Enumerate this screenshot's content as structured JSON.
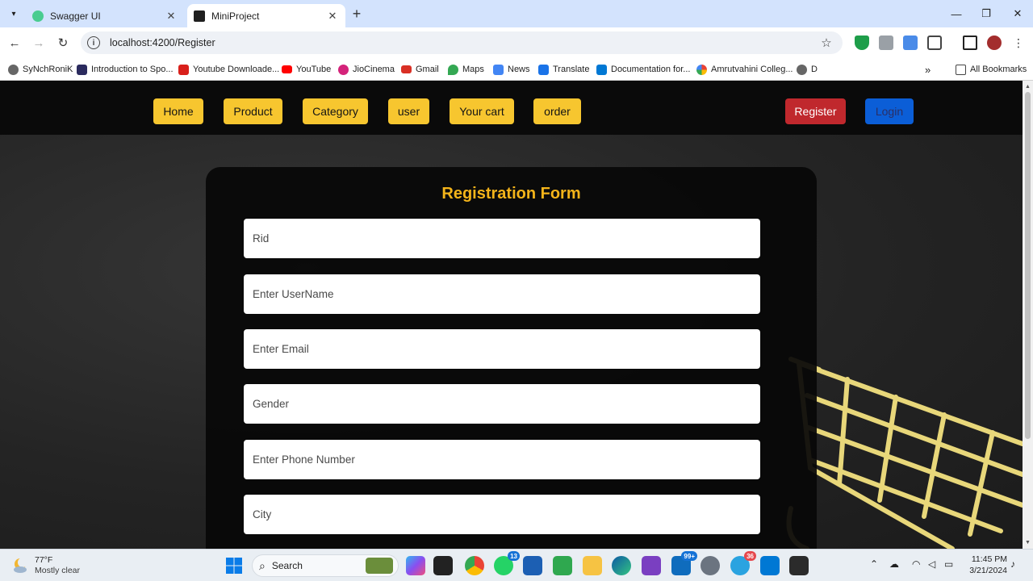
{
  "browser": {
    "tabs": [
      {
        "title": "Swagger UI",
        "active": false,
        "favicon_color": "#49cc90"
      },
      {
        "title": "MiniProject",
        "active": true,
        "favicon_color": "#1f1f1f"
      }
    ],
    "url": "localhost:4200/Register",
    "bookmarks": [
      {
        "label": "SyNchRoniK",
        "icon": "globe-icon",
        "color": "#555555"
      },
      {
        "label": "Introduction to Spo...",
        "icon": "page-icon",
        "color": "#2b2b5e"
      },
      {
        "label": "Youtube Downloade...",
        "icon": "red-download-icon",
        "color": "#d9201b"
      },
      {
        "label": "YouTube",
        "icon": "youtube-icon",
        "color": "#ff0000"
      },
      {
        "label": "JioCinema",
        "icon": "jiocinema-icon",
        "color": "#d4237a"
      },
      {
        "label": "Gmail",
        "icon": "gmail-icon",
        "color": "#d93025"
      },
      {
        "label": "Maps",
        "icon": "maps-icon",
        "color": "#34a853"
      },
      {
        "label": "News",
        "icon": "news-icon",
        "color": "#4285f4"
      },
      {
        "label": "Translate",
        "icon": "translate-icon",
        "color": "#1a73e8"
      },
      {
        "label": "Documentation for...",
        "icon": "vscode-icon",
        "color": "#0078d4"
      },
      {
        "label": "Amrutvahini Colleg...",
        "icon": "google-icon",
        "color": "#4285f4"
      },
      {
        "label": "D",
        "icon": "globe-icon",
        "color": "#555555"
      }
    ],
    "all_bookmarks": "All Bookmarks"
  },
  "navbar": {
    "items": [
      "Home",
      "Product",
      "Category",
      "user",
      "Your cart",
      "order"
    ],
    "register": "Register",
    "login": "Login",
    "accent": "#f7c62f",
    "register_color": "#c0282d",
    "login_color": "#0b5ed7"
  },
  "form": {
    "title": "Registration Form",
    "title_color": "#f4b41a",
    "fields": [
      {
        "placeholder": "Rid"
      },
      {
        "placeholder": "Enter UserName"
      },
      {
        "placeholder": "Enter Email"
      },
      {
        "placeholder": "Gender"
      },
      {
        "placeholder": "Enter Phone Number"
      },
      {
        "placeholder": "City"
      }
    ]
  },
  "taskbar": {
    "weather_temp": "77°F",
    "weather_cond": "Mostly clear",
    "search": "Search",
    "time": "11:45 PM",
    "date": "3/21/2024",
    "badges": {
      "whatsapp": "13",
      "mail": "99+",
      "telegram": "36"
    }
  }
}
